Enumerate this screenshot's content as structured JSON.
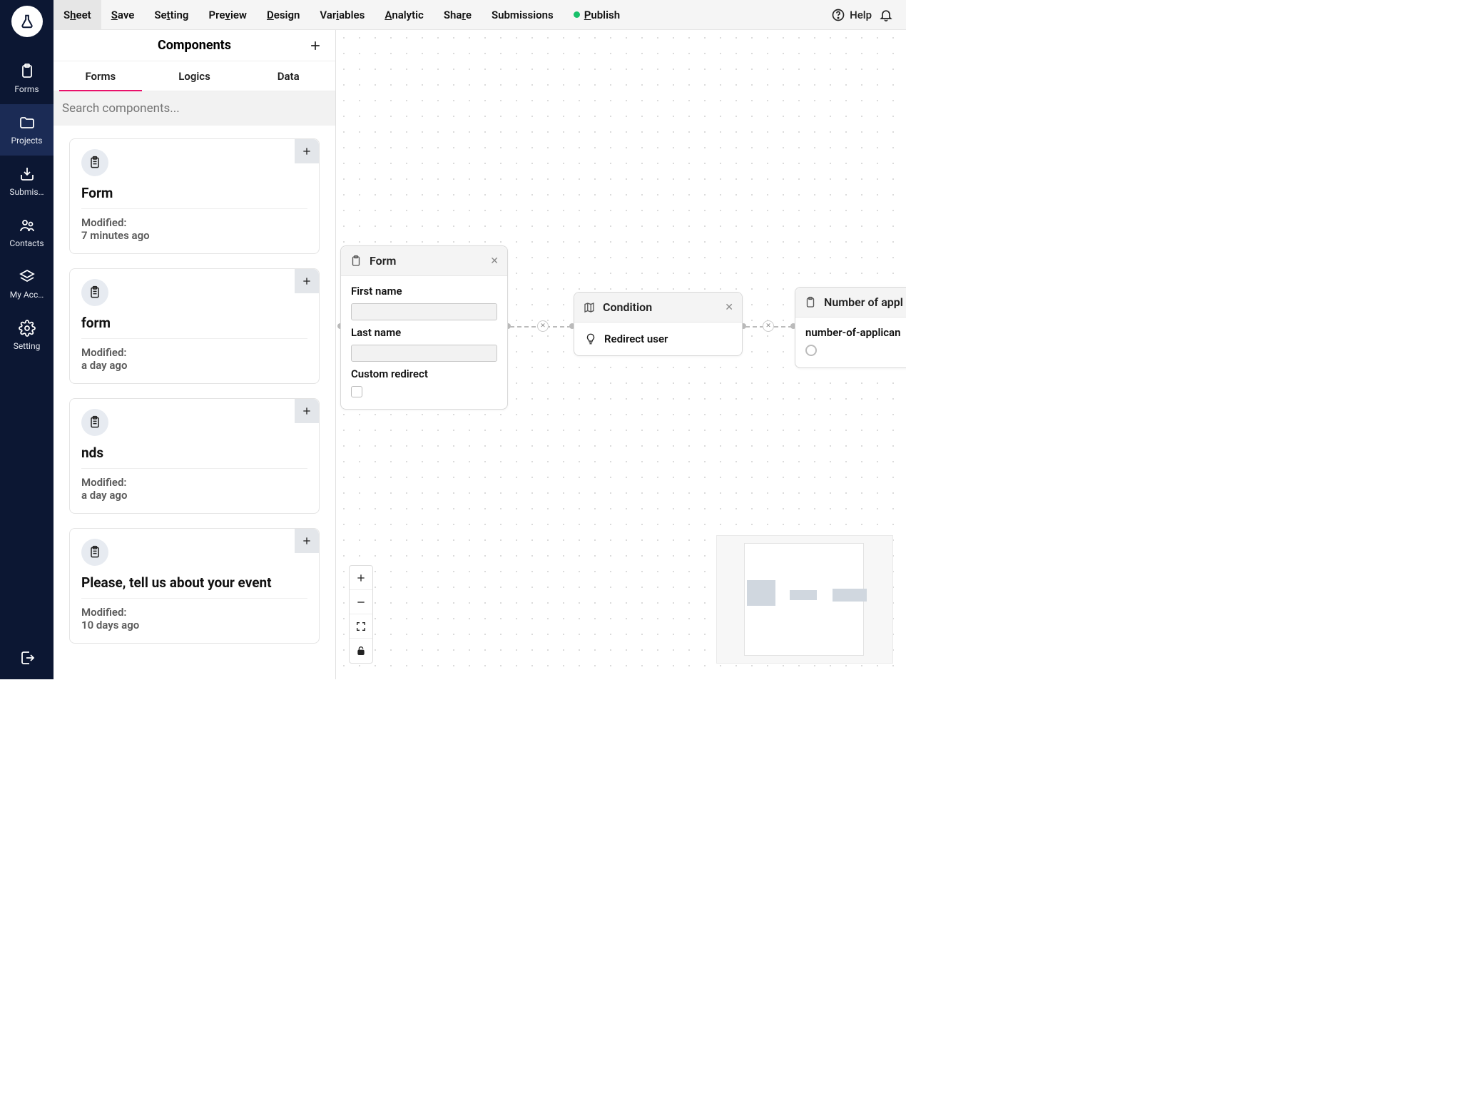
{
  "vnav": {
    "items": [
      {
        "label": "Forms"
      },
      {
        "label": "Projects"
      },
      {
        "label": "Submis…"
      },
      {
        "label": "Contacts"
      },
      {
        "label": "My Acc…"
      },
      {
        "label": "Setting"
      }
    ]
  },
  "topbar": {
    "sheet": "Sheet",
    "save": "Save",
    "setting": "Setting",
    "preview": "Preview",
    "design": "Design",
    "variables": "Variables",
    "analytic": "Analytic",
    "share": "Share",
    "submissions": "Submissions",
    "publish": "Publish",
    "help": "Help"
  },
  "panel": {
    "title": "Components",
    "tabs": {
      "forms": "Forms",
      "logics": "Logics",
      "data": "Data"
    },
    "search_placeholder": "Search components...",
    "cards": [
      {
        "title": "Form",
        "modified_label": "Modified:",
        "modified_value": "7 minutes ago"
      },
      {
        "title": "form",
        "modified_label": "Modified:",
        "modified_value": "a day ago"
      },
      {
        "title": "nds",
        "modified_label": "Modified:",
        "modified_value": "a day ago"
      },
      {
        "title": "Please, tell us about your event",
        "modified_label": "Modified:",
        "modified_value": "10 days ago"
      }
    ]
  },
  "canvas": {
    "form_node": {
      "title": "Form",
      "fields": {
        "first_name": "First name",
        "last_name": "Last name",
        "custom_redirect": "Custom redirect"
      }
    },
    "condition_node": {
      "title": "Condition",
      "action": "Redirect user"
    },
    "applicants_node": {
      "title": "Number of appl",
      "field": "number-of-applican"
    }
  }
}
